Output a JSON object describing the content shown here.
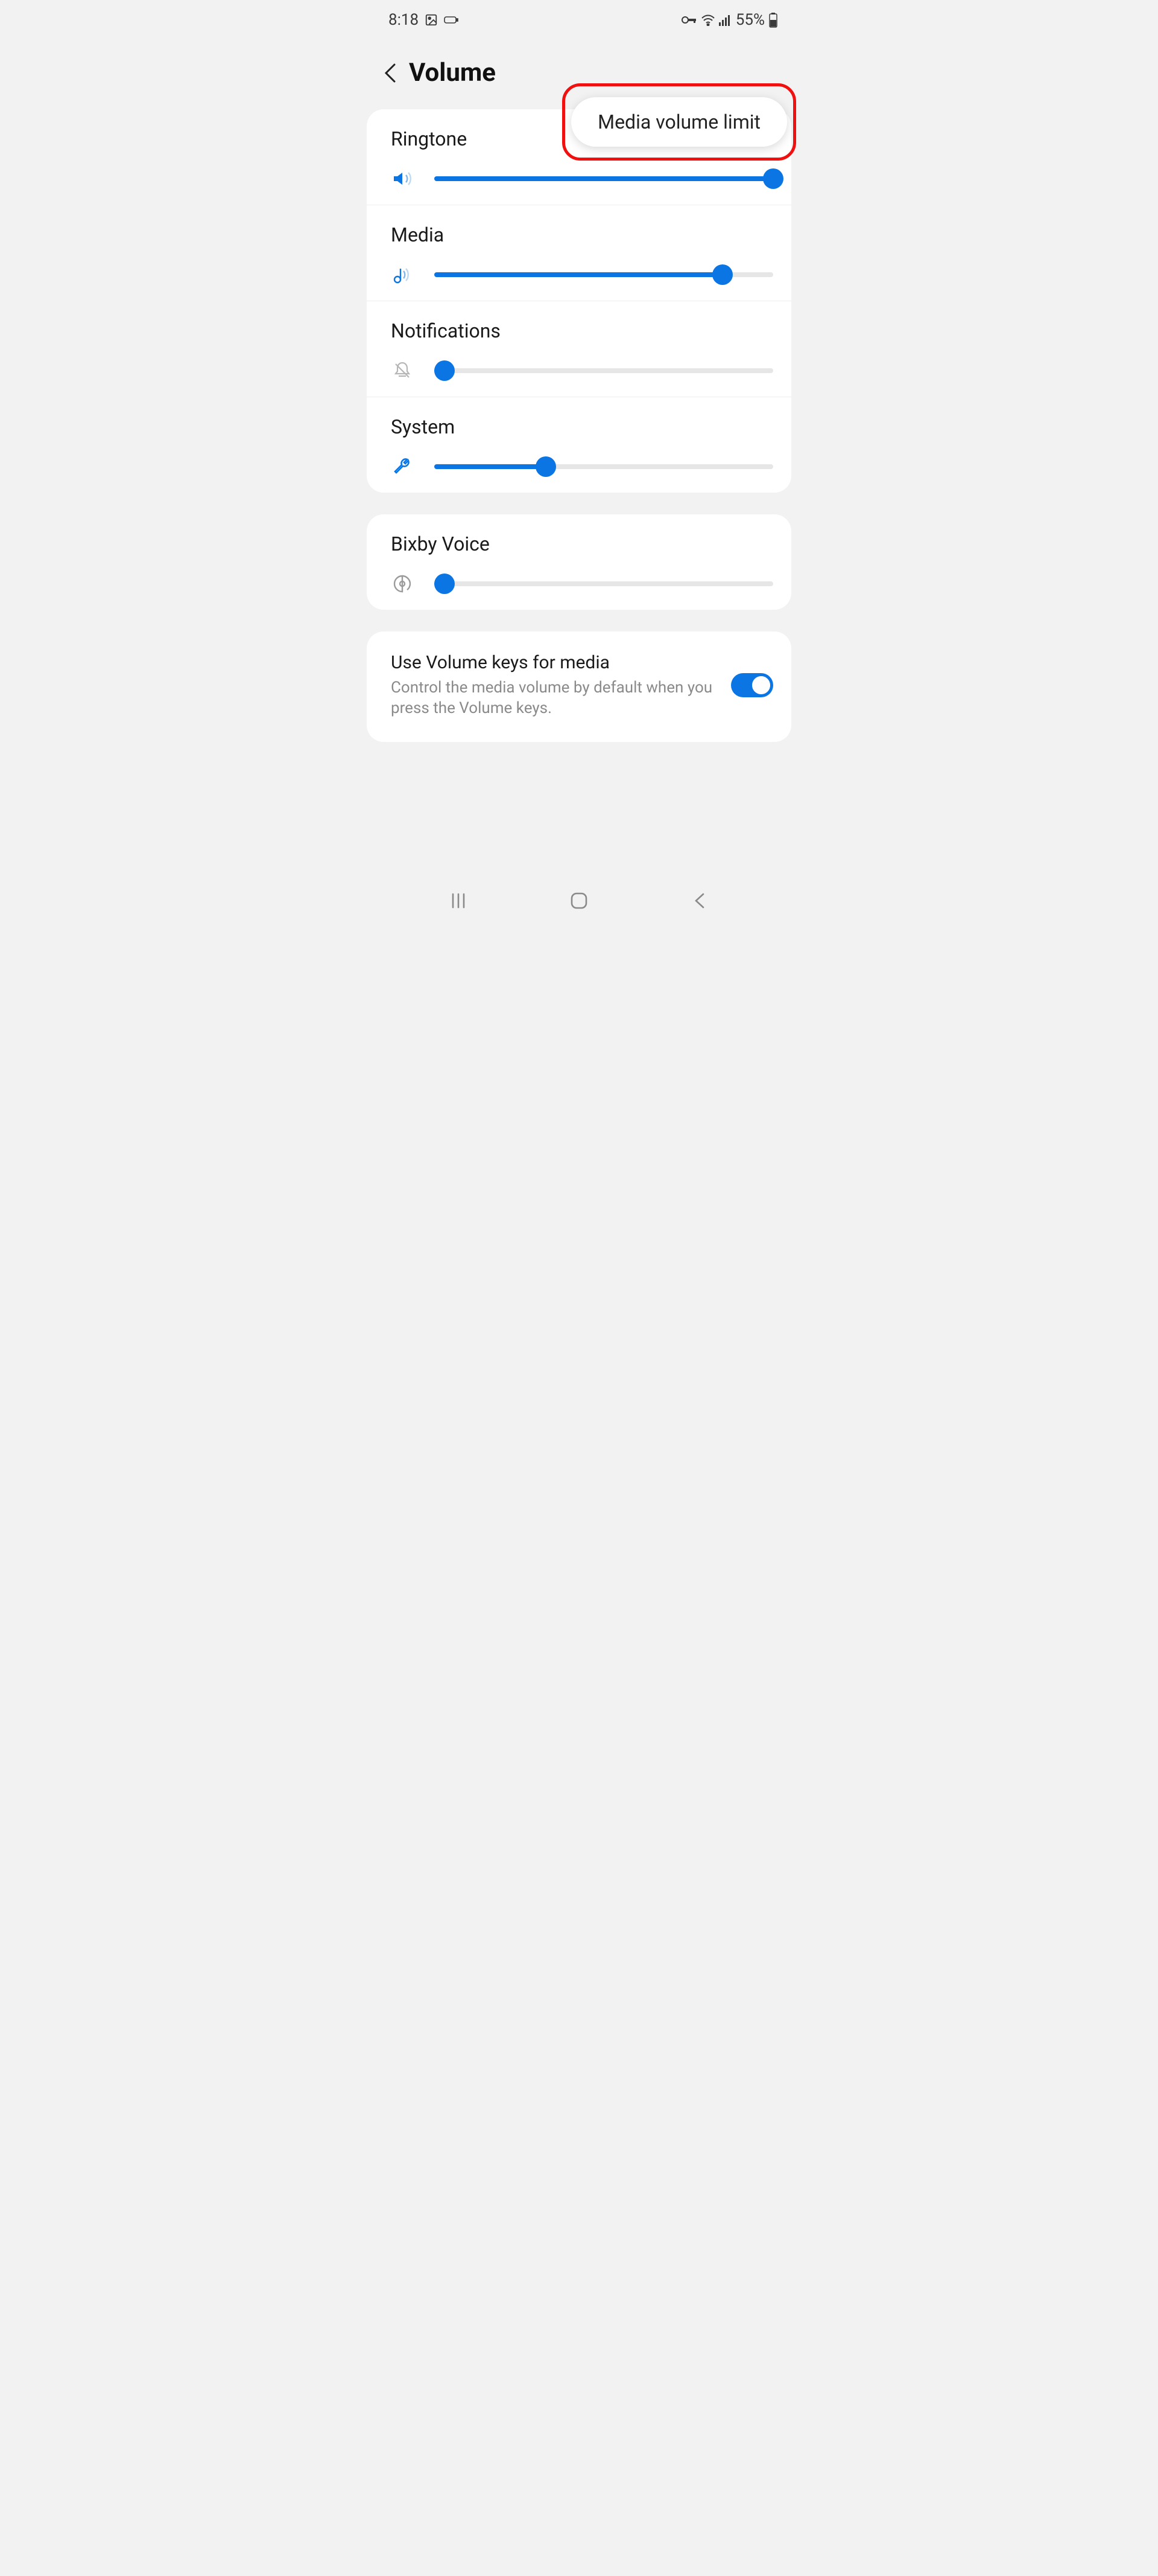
{
  "status": {
    "time": "8:18",
    "battery": "55%"
  },
  "header": {
    "title": "Volume",
    "popup": "Media volume limit"
  },
  "sliders": [
    {
      "label": "Ringtone",
      "value": 100,
      "icon": "speaker"
    },
    {
      "label": "Media",
      "value": 85,
      "icon": "music"
    },
    {
      "label": "Notifications",
      "value": 3,
      "icon": "bell-off"
    },
    {
      "label": "System",
      "value": 33,
      "icon": "wrench"
    }
  ],
  "bixby": {
    "label": "Bixby Voice",
    "value": 3,
    "icon": "bixby"
  },
  "mediaKeys": {
    "title": "Use Volume keys for media",
    "subtitle": "Control the media volume by default when you press the Volume keys.",
    "on": true
  },
  "colors": {
    "accent": "#0b76e3",
    "highlight": "#f01010"
  }
}
